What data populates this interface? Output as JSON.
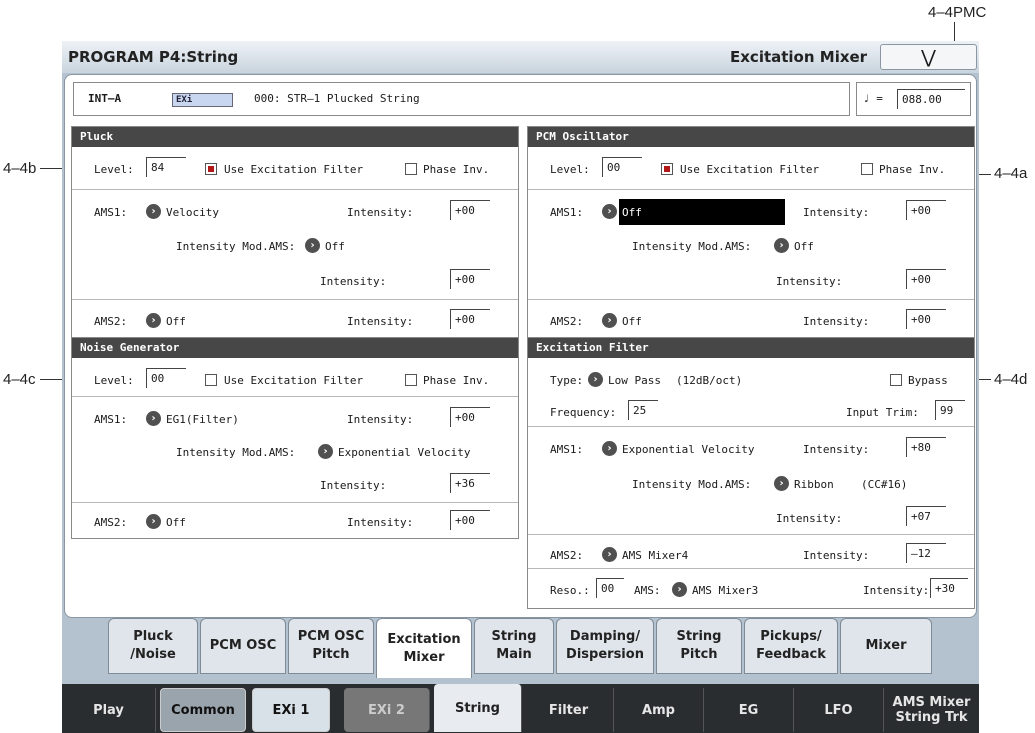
{
  "callouts": {
    "top_right": "4–4PMC",
    "left_1": "4–4b",
    "left_2": "4–4c",
    "right_1": "4–4a",
    "right_2": "4–4d"
  },
  "title": {
    "left": "PROGRAM P4:String",
    "page": "Excitation Mixer",
    "menu_icon": "chevron-down-icon"
  },
  "info": {
    "bank": "INT–A",
    "badge": "EXi",
    "program": "000: STR–1 Plucked String",
    "tempo_symbol": "♩ =",
    "tempo_value": "088.00"
  },
  "pluck": {
    "header": "Pluck",
    "level_label": "Level:",
    "level_value": "84",
    "use_filter_label": "Use Excitation Filter",
    "use_filter_checked": true,
    "phase_label": "Phase Inv.",
    "phase_checked": false,
    "ams1_label": "AMS1:",
    "ams1_value": "Velocity",
    "intensity_label": "Intensity:",
    "ams1_intensity": "+00",
    "int_mod_label": "Intensity Mod.AMS:",
    "int_mod_value": "Off",
    "int_mod_intensity": "+00",
    "ams2_label": "AMS2:",
    "ams2_value": "Off",
    "ams2_intensity": "+00"
  },
  "pcm": {
    "header": "PCM Oscillator",
    "level_label": "Level:",
    "level_value": "00",
    "use_filter_label": "Use Excitation Filter",
    "use_filter_checked": true,
    "phase_label": "Phase Inv.",
    "phase_checked": false,
    "ams1_label": "AMS1:",
    "ams1_value": "Off",
    "intensity_label": "Intensity:",
    "ams1_intensity": "+00",
    "int_mod_label": "Intensity Mod.AMS:",
    "int_mod_value": "Off",
    "int_mod_intensity": "+00",
    "ams2_label": "AMS2:",
    "ams2_value": "Off",
    "ams2_intensity": "+00"
  },
  "noise": {
    "header": "Noise Generator",
    "level_label": "Level:",
    "level_value": "00",
    "use_filter_label": "Use Excitation Filter",
    "use_filter_checked": false,
    "phase_label": "Phase Inv.",
    "phase_checked": false,
    "ams1_label": "AMS1:",
    "ams1_value": "EG1(Filter)",
    "intensity_label": "Intensity:",
    "ams1_intensity": "+00",
    "int_mod_label": "Intensity Mod.AMS:",
    "int_mod_value": "Exponential Velocity",
    "int_mod_intensity": "+36",
    "ams2_label": "AMS2:",
    "ams2_value": "Off",
    "ams2_intensity": "+00"
  },
  "excfilter": {
    "header": "Excitation Filter",
    "type_label": "Type:",
    "type_value": "Low Pass",
    "type_detail": "(12dB/oct)",
    "bypass_label": "Bypass",
    "bypass_checked": false,
    "freq_label": "Frequency:",
    "freq_value": "25",
    "trim_label": "Input Trim:",
    "trim_value": "99",
    "ams1_label": "AMS1:",
    "ams1_value": "Exponential Velocity",
    "intensity_label": "Intensity:",
    "ams1_intensity": "+80",
    "int_mod_label": "Intensity Mod.AMS:",
    "int_mod_value": "Ribbon",
    "int_mod_detail": "(CC#16)",
    "int_mod_intensity": "+07",
    "ams2_label": "AMS2:",
    "ams2_value": "AMS Mixer4",
    "ams2_intensity": "–12",
    "reso_label": "Reso.:",
    "reso_value": "00",
    "reso_ams_label": "AMS:",
    "reso_ams_value": "AMS Mixer3",
    "reso_intensity": "+30"
  },
  "tabs": [
    {
      "line1": "Pluck",
      "line2": "/Noise"
    },
    {
      "line1": "PCM OSC",
      "line2": ""
    },
    {
      "line1": "PCM OSC",
      "line2": "Pitch"
    },
    {
      "line1": "Excitation",
      "line2": "Mixer"
    },
    {
      "line1": "String",
      "line2": "Main"
    },
    {
      "line1": "Damping/",
      "line2": "Dispersion"
    },
    {
      "line1": "String",
      "line2": "Pitch"
    },
    {
      "line1": "Pickups/",
      "line2": "Feedback"
    },
    {
      "line1": "Mixer",
      "line2": ""
    }
  ],
  "pages": [
    {
      "line1": "Play",
      "line2": ""
    },
    {
      "line1": "Common",
      "line2": ""
    },
    {
      "line1": "EXi 1",
      "line2": ""
    },
    {
      "line1": "EXi 2",
      "line2": ""
    },
    {
      "line1": "String",
      "line2": ""
    },
    {
      "line1": "Filter",
      "line2": ""
    },
    {
      "line1": "Amp",
      "line2": ""
    },
    {
      "line1": "EG",
      "line2": ""
    },
    {
      "line1": "LFO",
      "line2": ""
    },
    {
      "line1": "AMS Mixer",
      "line2": "String Trk"
    }
  ]
}
